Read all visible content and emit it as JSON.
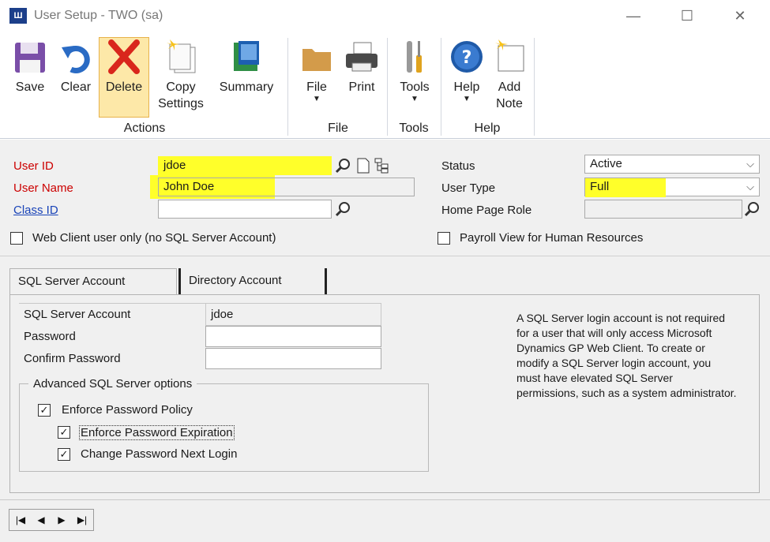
{
  "window": {
    "app_logo": "Ш",
    "title": "User Setup - TWO (sa)",
    "minimize": "—",
    "maximize": "☐",
    "close": "✕"
  },
  "ribbon": {
    "buttons": {
      "save": "Save",
      "clear": "Clear",
      "delete": "Delete",
      "copy_settings": "Copy\nSettings",
      "summary": "Summary",
      "file": "File",
      "print": "Print",
      "tools": "Tools",
      "help": "Help",
      "add_note": "Add\nNote"
    },
    "groups": {
      "actions": "Actions",
      "file": "File",
      "tools": "Tools",
      "help": "Help"
    },
    "dropdown_arrow": "▼",
    "help_icon_glyph": "?"
  },
  "form": {
    "user_id": {
      "label": "User ID",
      "value": "jdoe"
    },
    "user_name": {
      "label": "User Name",
      "value": "John Doe"
    },
    "class_id": {
      "label": "Class ID",
      "value": ""
    },
    "web_client_only": {
      "label": "Web Client user only (no SQL Server Account)",
      "checked": false
    },
    "status": {
      "label": "Status",
      "value": "Active"
    },
    "user_type": {
      "label": "User Type",
      "value": "Full"
    },
    "home_page_role": {
      "label": "Home Page Role",
      "value": ""
    },
    "payroll_view": {
      "label": "Payroll View for Human Resources",
      "checked": false
    },
    "select_arrow": "⌵"
  },
  "tabs": {
    "sql_server_account": "SQL Server Account",
    "directory_account": "Directory Account"
  },
  "sql_panel": {
    "sql_account": {
      "label": "SQL Server Account",
      "value": "jdoe"
    },
    "password": {
      "label": "Password",
      "value": ""
    },
    "confirm_password": {
      "label": "Confirm Password",
      "value": ""
    },
    "advanced_title": "Advanced SQL Server options",
    "enforce_policy": {
      "label": "Enforce Password Policy",
      "checked": true
    },
    "enforce_expiration": {
      "label": "Enforce Password Expiration",
      "checked": true
    },
    "change_next_login": {
      "label": "Change Password Next Login",
      "checked": true
    },
    "info_text": "A SQL Server login account is not required for a user that will only access Microsoft Dynamics GP Web Client. To create or modify a SQL Server login account, you must have elevated SQL Server permissions, such as a system administrator.",
    "check_glyph": "✓"
  },
  "navigation": {
    "first": "|◀",
    "previous": "◀",
    "next": "▶",
    "last": "▶|"
  },
  "colors": {
    "highlight": "#ffff2a",
    "required_label": "#cc0000",
    "link": "#1a44b8",
    "delete_active_bg": "#fde8a8"
  }
}
